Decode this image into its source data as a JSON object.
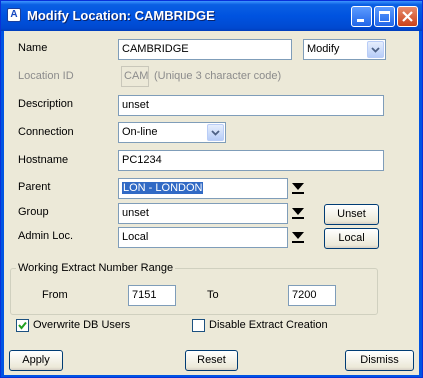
{
  "window": {
    "title": "Modify Location: CAMBRIDGE",
    "app_icon": "A"
  },
  "form": {
    "name_label": "Name",
    "name_value": "CAMBRIDGE",
    "mode_value": "Modify",
    "location_id_label": "Location ID",
    "location_id_value": "CAM",
    "location_id_hint": "(Unique 3 character code)",
    "description_label": "Description",
    "description_value": "unset",
    "connection_label": "Connection",
    "connection_value": "On-line",
    "hostname_label": "Hostname",
    "hostname_value": "PC1234",
    "parent_label": "Parent",
    "parent_value": "LON - LONDON",
    "group_label": "Group",
    "group_value": "unset",
    "group_button": "Unset",
    "admin_label": "Admin Loc.",
    "admin_value": "Local",
    "admin_button": "Local"
  },
  "range": {
    "title": "Working Extract Number Range",
    "from_label": "From",
    "from_value": "7151",
    "to_label": "To",
    "to_value": "7200"
  },
  "options": {
    "overwrite_label": "Overwrite DB Users",
    "overwrite_checked": true,
    "disable_extract_label": "Disable Extract Creation",
    "disable_extract_checked": false
  },
  "buttons": {
    "apply": "Apply",
    "reset": "Reset",
    "dismiss": "Dismiss"
  },
  "colors": {
    "titlebar": "#0054e3",
    "dialog_bg": "#ece9d8",
    "selection": "#316ac5",
    "check_mark": "#21a121"
  }
}
